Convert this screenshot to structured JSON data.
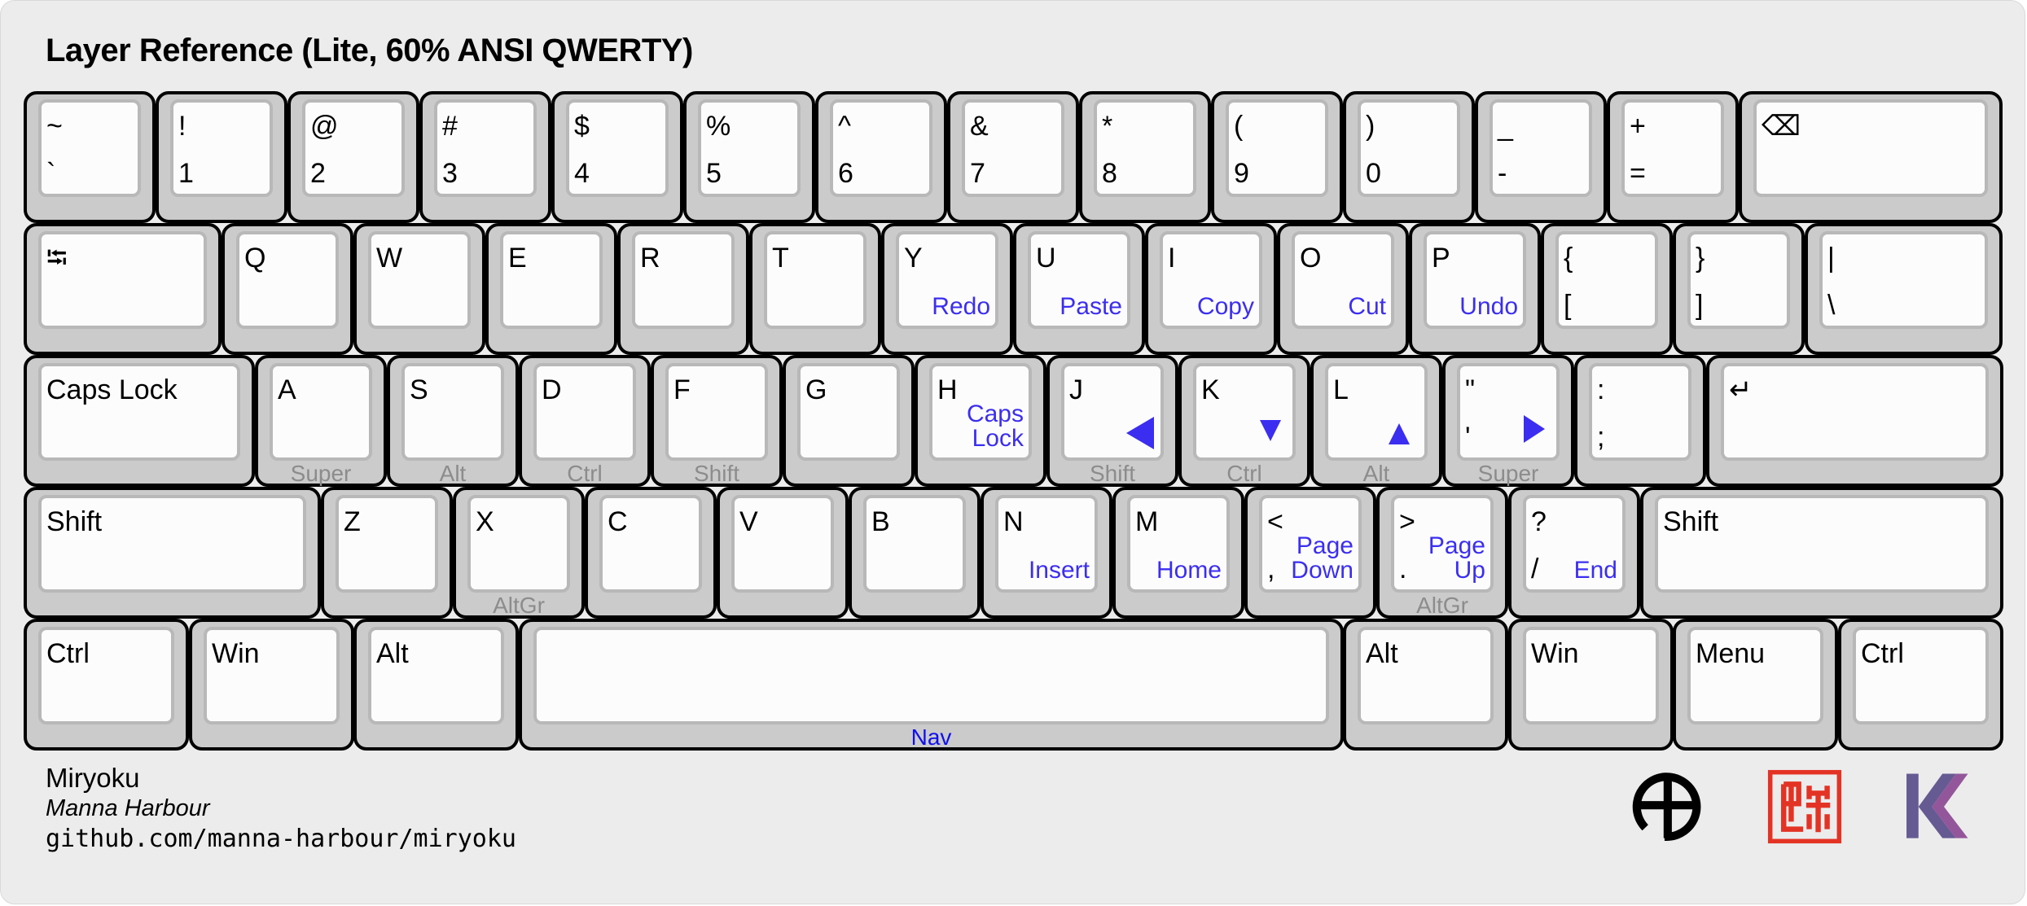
{
  "title": "Layer Reference (Lite, 60% ANSI QWERTY)",
  "colors": {
    "layer_label": "#3b2ef0",
    "nav_label": "#1010ee",
    "hold_label": "#8c8c8c",
    "key_body": "#cbcbcb",
    "keycap": "#fcfcfc",
    "panel_bg": "#ececec"
  },
  "rows": [
    [
      {
        "id": "grave",
        "w": 1,
        "top": "~",
        "bottom": "`"
      },
      {
        "id": "1",
        "w": 1,
        "top": "!",
        "bottom": "1"
      },
      {
        "id": "2",
        "w": 1,
        "top": "@",
        "bottom": "2"
      },
      {
        "id": "3",
        "w": 1,
        "top": "#",
        "bottom": "3"
      },
      {
        "id": "4",
        "w": 1,
        "top": "$",
        "bottom": "4"
      },
      {
        "id": "5",
        "w": 1,
        "top": "%",
        "bottom": "5"
      },
      {
        "id": "6",
        "w": 1,
        "top": "^",
        "bottom": "6"
      },
      {
        "id": "7",
        "w": 1,
        "top": "&",
        "bottom": "7"
      },
      {
        "id": "8",
        "w": 1,
        "top": "*",
        "bottom": "8"
      },
      {
        "id": "9",
        "w": 1,
        "top": "(",
        "bottom": "9"
      },
      {
        "id": "0",
        "w": 1,
        "top": ")",
        "bottom": "0"
      },
      {
        "id": "minus",
        "w": 1,
        "top": "_",
        "bottom": "-"
      },
      {
        "id": "equal",
        "w": 1,
        "top": "+",
        "bottom": "="
      },
      {
        "id": "backspace",
        "w": 2,
        "top": "⌫",
        "icon": "backspace-icon"
      }
    ],
    [
      {
        "id": "tab",
        "w": 1.5,
        "top": "⭾",
        "icon": "tab-icon"
      },
      {
        "id": "q",
        "w": 1,
        "top": "Q"
      },
      {
        "id": "w",
        "w": 1,
        "top": "W"
      },
      {
        "id": "e",
        "w": 1,
        "top": "E"
      },
      {
        "id": "r",
        "w": 1,
        "top": "R"
      },
      {
        "id": "t",
        "w": 1,
        "top": "T"
      },
      {
        "id": "y",
        "w": 1,
        "top": "Y",
        "layer": "Redo"
      },
      {
        "id": "u",
        "w": 1,
        "top": "U",
        "layer": "Paste"
      },
      {
        "id": "i",
        "w": 1,
        "top": "I",
        "layer": "Copy"
      },
      {
        "id": "o",
        "w": 1,
        "top": "O",
        "layer": "Cut"
      },
      {
        "id": "p",
        "w": 1,
        "top": "P",
        "layer": "Undo"
      },
      {
        "id": "lbracket",
        "w": 1,
        "top": "{",
        "bottom": "["
      },
      {
        "id": "rbracket",
        "w": 1,
        "top": "}",
        "bottom": "]"
      },
      {
        "id": "backslash",
        "w": 1.5,
        "top": "|",
        "bottom": "\\"
      }
    ],
    [
      {
        "id": "capslock",
        "w": 1.75,
        "top": "Caps Lock"
      },
      {
        "id": "a",
        "w": 1,
        "top": "A",
        "hold": "Super"
      },
      {
        "id": "s",
        "w": 1,
        "top": "S",
        "hold": "Alt"
      },
      {
        "id": "d",
        "w": 1,
        "top": "D",
        "hold": "Ctrl"
      },
      {
        "id": "f",
        "w": 1,
        "top": "F",
        "hold": "Shift"
      },
      {
        "id": "g",
        "w": 1,
        "top": "G"
      },
      {
        "id": "h",
        "w": 1,
        "top": "H",
        "layer": "Caps\nLock"
      },
      {
        "id": "j",
        "w": 1,
        "top": "J",
        "arrow": "left",
        "hold": "Shift"
      },
      {
        "id": "k",
        "w": 1,
        "top": "K",
        "arrow": "down",
        "hold": "Ctrl"
      },
      {
        "id": "l",
        "w": 1,
        "top": "L",
        "arrow": "up",
        "hold": "Alt"
      },
      {
        "id": "quote",
        "w": 1,
        "top": "\"",
        "bottom": "'",
        "arrow": "right",
        "hold": "Super"
      },
      {
        "id": "semicolon",
        "w": 1,
        "top": ":",
        "bottom": ";"
      },
      {
        "id": "enter",
        "w": 2.25,
        "top": "↵",
        "icon": "enter-icon"
      }
    ],
    [
      {
        "id": "lshift",
        "w": 2.25,
        "top": "Shift"
      },
      {
        "id": "z",
        "w": 1,
        "top": "Z"
      },
      {
        "id": "x",
        "w": 1,
        "top": "X",
        "hold": "AltGr"
      },
      {
        "id": "c",
        "w": 1,
        "top": "C"
      },
      {
        "id": "v",
        "w": 1,
        "top": "V"
      },
      {
        "id": "b",
        "w": 1,
        "top": "B"
      },
      {
        "id": "n",
        "w": 1,
        "top": "N",
        "layer": "Insert"
      },
      {
        "id": "m",
        "w": 1,
        "top": "M",
        "layer": "Home"
      },
      {
        "id": "comma",
        "w": 1,
        "top": "<",
        "bottom": ",",
        "layer": "Page\nDown"
      },
      {
        "id": "period",
        "w": 1,
        "top": ">",
        "bottom": ".",
        "layer": "Page\nUp",
        "hold": "AltGr"
      },
      {
        "id": "slash",
        "w": 1,
        "top": "?",
        "bottom": "/",
        "layer": "End"
      },
      {
        "id": "rshift",
        "w": 2.75,
        "top": "Shift"
      }
    ],
    [
      {
        "id": "lctrl",
        "w": 1.25,
        "top": "Ctrl"
      },
      {
        "id": "lwin",
        "w": 1.25,
        "top": "Win"
      },
      {
        "id": "lalt",
        "w": 1.25,
        "top": "Alt"
      },
      {
        "id": "space",
        "w": 6.25,
        "hold": "Nav",
        "holdClass": "nav"
      },
      {
        "id": "ralt",
        "w": 1.25,
        "top": "Alt"
      },
      {
        "id": "rwin",
        "w": 1.25,
        "top": "Win"
      },
      {
        "id": "menu",
        "w": 1.25,
        "top": "Menu"
      },
      {
        "id": "rctrl",
        "w": 1.25,
        "top": "Ctrl"
      }
    ]
  ],
  "footer": {
    "name": "Miryoku",
    "author": "Manna Harbour",
    "url": "github.com/manna-harbour/miryoku"
  },
  "logos": [
    {
      "name": "miryoku-logo-icon"
    },
    {
      "name": "seal-logo-icon"
    },
    {
      "name": "kmonad-logo-icon"
    }
  ]
}
